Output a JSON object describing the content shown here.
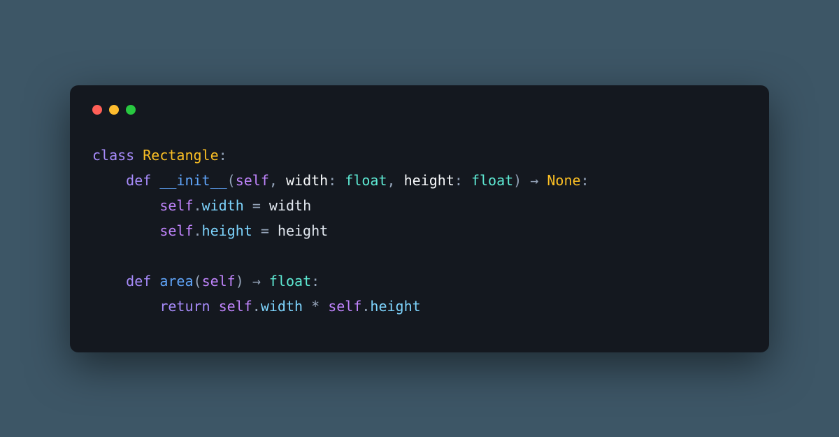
{
  "window": {
    "trafficLights": [
      "red",
      "yellow",
      "green"
    ]
  },
  "code": {
    "kw_class": "class",
    "classname": "Rectangle",
    "colon": ":",
    "kw_def": "def",
    "fn_init": "__init__",
    "lparen": "(",
    "rparen": ")",
    "self": "self",
    "comma": ",",
    "param_width": "width",
    "param_height": "height",
    "type_float": "float",
    "type_none": "None",
    "arrow": "→",
    "eq": "=",
    "dot": ".",
    "prop_width": "width",
    "prop_height": "height",
    "fn_area": "area",
    "kw_return": "return",
    "star": "*",
    "sp": " ",
    "indent1": "    ",
    "indent2": "        "
  }
}
